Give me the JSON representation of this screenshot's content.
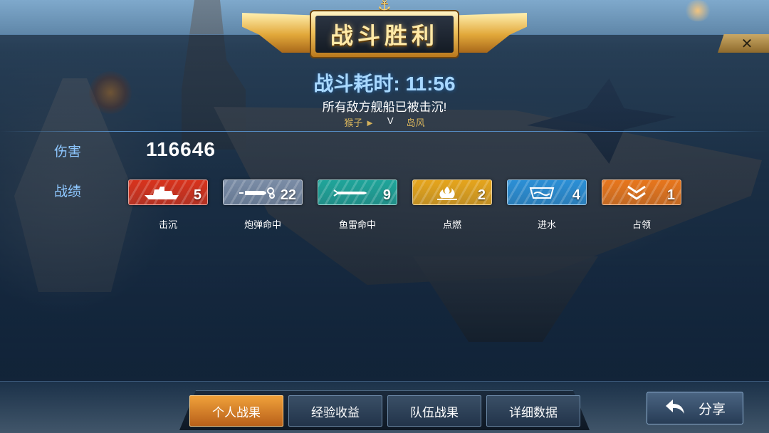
{
  "banner": {
    "title": "战斗胜利"
  },
  "battle": {
    "time_label": "战斗耗时: 11:56",
    "result_message": "所有敌方舰船已被击沉!",
    "player_left": "猴子 ►",
    "versus": "V",
    "player_right": "岛风"
  },
  "summary": {
    "damage_label": "伤害",
    "damage_value": "116646",
    "record_label": "战绩"
  },
  "stats": [
    {
      "label": "击沉",
      "count": "5",
      "icon": "ship-icon",
      "color": "#d9331c"
    },
    {
      "label": "炮弹命中",
      "count": "22",
      "icon": "shell-icon",
      "color": "#7a8ca6"
    },
    {
      "label": "鱼雷命中",
      "count": "9",
      "icon": "torpedo-icon",
      "color": "#1fa59a"
    },
    {
      "label": "点燃",
      "count": "2",
      "icon": "fire-icon",
      "color": "#e6a51c"
    },
    {
      "label": "进水",
      "count": "4",
      "icon": "water-icon",
      "color": "#2b8fd6"
    },
    {
      "label": "占领",
      "count": "1",
      "icon": "chevron-capture-icon",
      "color": "#e8761c"
    }
  ],
  "tabs": [
    {
      "label": "个人战果",
      "active": true
    },
    {
      "label": "经验收益",
      "active": false
    },
    {
      "label": "队伍战果",
      "active": false
    },
    {
      "label": "详细数据",
      "active": false
    }
  ],
  "share": {
    "label": "分享",
    "icon": "back-arrow-icon"
  },
  "close": {
    "icon": "close-icon"
  }
}
